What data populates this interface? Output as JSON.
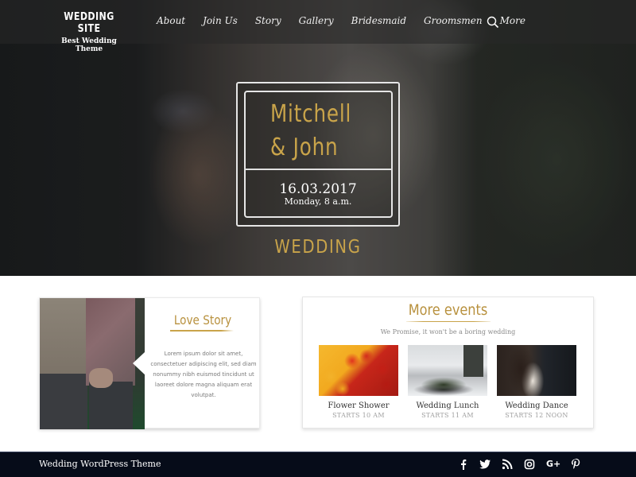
{
  "brand": {
    "title": "WEDDING SITE",
    "subtitle": "Best Wedding Theme"
  },
  "nav": {
    "items": [
      {
        "label": "About"
      },
      {
        "label": "Join Us"
      },
      {
        "label": "Story"
      },
      {
        "label": "Gallery"
      },
      {
        "label": "Bridesmaid"
      },
      {
        "label": "Groomsmen"
      },
      {
        "label": "More"
      }
    ],
    "search_icon": "search-icon"
  },
  "hero": {
    "couple_line1": "Mitchell",
    "couple_line2": "& John",
    "date": "16.03.2017",
    "day_time": "Monday, 8 a.m.",
    "event_label": "WEDDING"
  },
  "love_story": {
    "title": "Love Story",
    "text": "Lorem ipsum dolor sit amet, consectetuer adipiscing elit, sed diam nonummy nibh euismod tincidunt ut laoreet dolore magna aliquam erat volutpat."
  },
  "more_events": {
    "title": "More events",
    "subtitle": "We Promise, it won't be a boring wedding",
    "events": [
      {
        "name": "Flower Shower",
        "time": "STARTS 10 AM"
      },
      {
        "name": "Wedding Lunch",
        "time": "STARTS 11 AM"
      },
      {
        "name": "Wedding Dance",
        "time": "STARTS 12 NOON"
      }
    ]
  },
  "footer": {
    "title": "Wedding WordPress Theme",
    "social": [
      {
        "icon": "facebook-icon",
        "glyph": "f"
      },
      {
        "icon": "twitter-icon",
        "glyph": "t"
      },
      {
        "icon": "rss-icon",
        "glyph": "rss"
      },
      {
        "icon": "instagram-icon",
        "glyph": "ig"
      },
      {
        "icon": "google-plus-icon",
        "glyph": "G+"
      },
      {
        "icon": "pinterest-icon",
        "glyph": "P"
      }
    ]
  },
  "colors": {
    "gold_accent": "#c9a44a",
    "footer_bg": "#060c19",
    "white": "#ffffff"
  }
}
